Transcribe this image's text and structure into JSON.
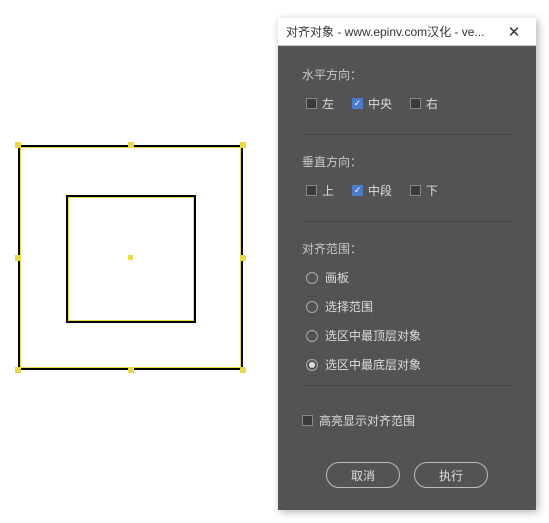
{
  "dialog": {
    "title": "对齐对象 - www.epinv.com汉化 - ve...",
    "horizontal": {
      "label": "水平方向：",
      "options": {
        "left": "左",
        "center": "中央",
        "right": "右"
      },
      "checked": "center"
    },
    "vertical": {
      "label": "垂直方向：",
      "options": {
        "top": "上",
        "middle": "中段",
        "bottom": "下"
      },
      "checked": "middle"
    },
    "scope": {
      "label": "对齐范围：",
      "options": {
        "artboard": "画板",
        "selection": "选择范围",
        "topmost": "选区中最顶层对象",
        "bottommost": "选区中最底层对象"
      },
      "selected": "bottommost"
    },
    "highlight_label": "高亮显示对齐范围",
    "buttons": {
      "cancel": "取消",
      "execute": "执行"
    }
  }
}
